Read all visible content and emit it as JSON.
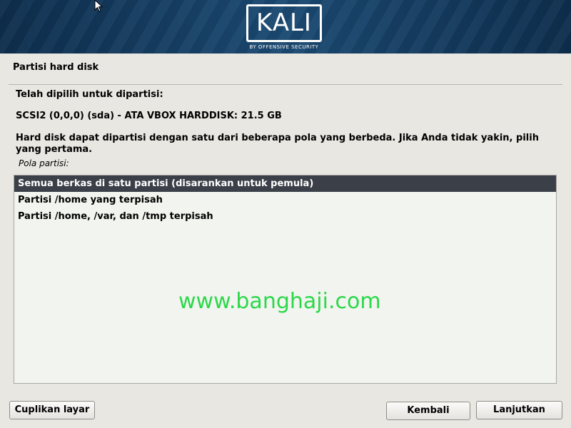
{
  "banner": {
    "logo_text": "KALI",
    "logo_subtitle": "BY OFFENSIVE SECURITY"
  },
  "page": {
    "title": "Partisi hard disk"
  },
  "content": {
    "selected_heading": "Telah dipilih untuk dipartisi:",
    "disk_info": "SCSI2 (0,0,0) (sda) - ATA VBOX HARDDISK: 21.5 GB",
    "description": "Hard disk dapat dipartisi dengan satu dari beberapa pola yang berbeda. Jika Anda tidak yakin, pilih yang pertama.",
    "list_label": "Pola partisi:",
    "options": [
      {
        "label": "Semua berkas di satu partisi (disarankan untuk pemula)",
        "selected": true
      },
      {
        "label": "Partisi /home yang terpisah",
        "selected": false
      },
      {
        "label": "Partisi /home, /var, dan /tmp terpisah",
        "selected": false
      }
    ]
  },
  "watermark": "www.banghaji.com",
  "buttons": {
    "screenshot": "Cuplikan layar",
    "back": "Kembali",
    "continue": "Lanjutkan"
  },
  "colors": {
    "banner": "#1b4a73",
    "selection": "#3b3f48",
    "watermark": "#2cd84a"
  }
}
